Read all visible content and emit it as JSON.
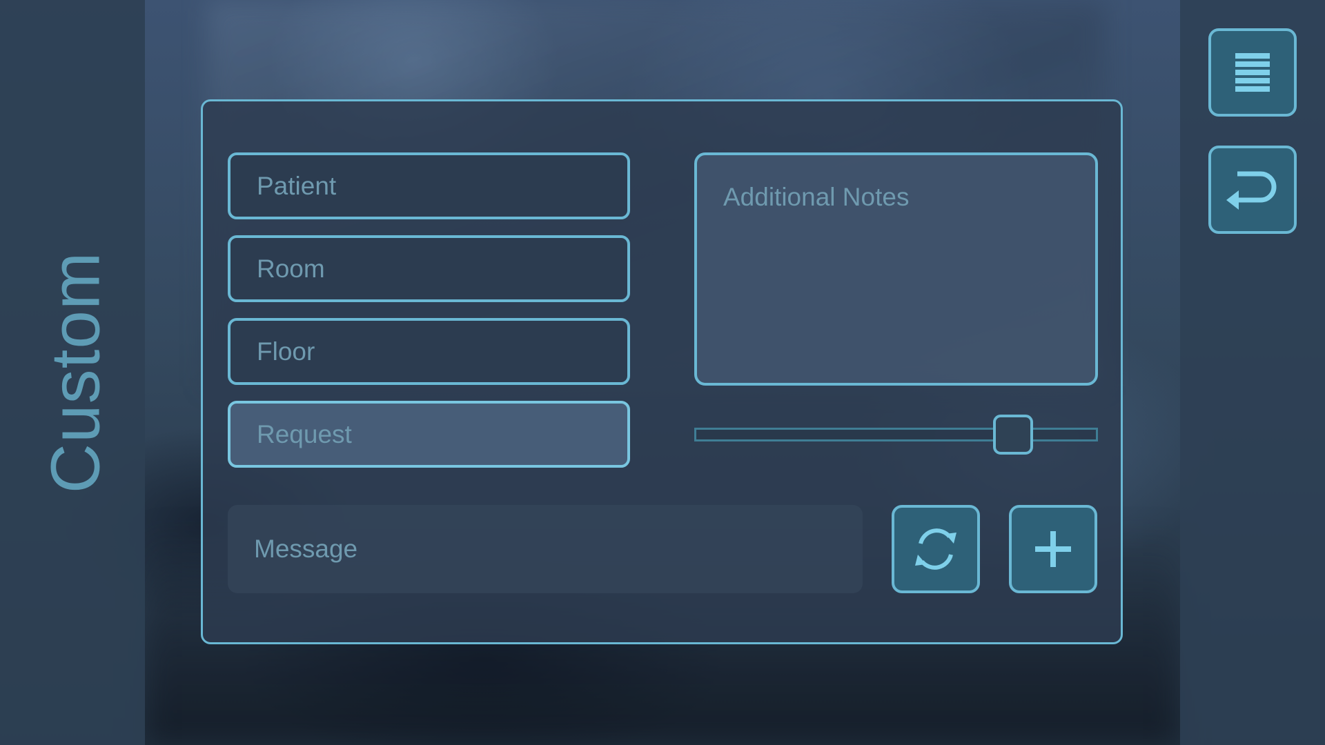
{
  "sidebar": {
    "title": "Custom"
  },
  "form": {
    "fields": [
      {
        "label": "Patient"
      },
      {
        "label": "Room"
      },
      {
        "label": "Floor"
      },
      {
        "label": "Request"
      }
    ],
    "active_field": "Request",
    "notes_placeholder": "Additional Notes",
    "message_placeholder": "Message",
    "slider_value_fraction": 0.79
  },
  "actions": {
    "refresh_icon": "refresh-icon",
    "add_icon": "plus-icon"
  },
  "toolbar": {
    "menu_icon": "menu-icon",
    "back_icon": "return-icon"
  },
  "colors": {
    "accent": "#6ab8d4",
    "button_fill": "#2e6178",
    "panel": "#2d3c50",
    "text_muted": "#6f9aaf",
    "title": "#5e9cb5"
  }
}
